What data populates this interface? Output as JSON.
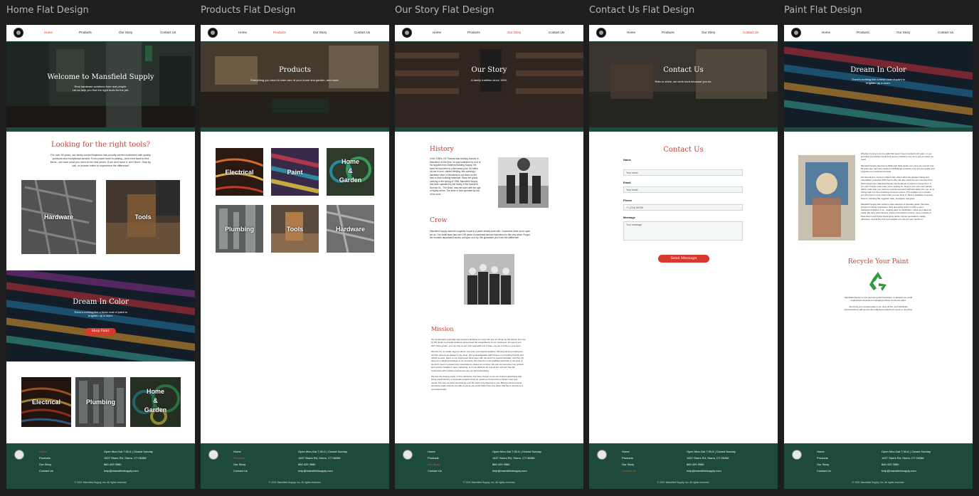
{
  "frames": [
    {
      "title": "Home Flat Design",
      "active_nav": "Home"
    },
    {
      "title": "Products Flat Design",
      "active_nav": "Products"
    },
    {
      "title": "Our Story Flat Design",
      "active_nav": "Our Story"
    },
    {
      "title": "Contact Us Flat Design",
      "active_nav": "Contact Us"
    },
    {
      "title": "Paint Flat Design",
      "active_nav": ""
    }
  ],
  "nav": [
    "Home",
    "Products",
    "Our Story",
    "Contact Us"
  ],
  "home": {
    "hero_title": "Welcome to Mansfield Supply",
    "hero_sub_1": "Real hardware solutions from real people.",
    "hero_sub_2": "Let us help you find the right tools for the job.",
    "heading": "Looking for the right tools?",
    "intro_1": "For over 50 years, our family-owned business has proudly carried customers with quality",
    "intro_2": "products and exceptional service. From power tools to plating—and even hard-to-find",
    "intro_3": "items—we have what you need at the best prices. If we don't have it, we'll find it. Stop by,",
    "intro_4": "call, or browse online to experience the difference!",
    "tile_hardware": "Hardware",
    "tile_tools": "Tools",
    "dream_title": "Dream In Color",
    "dream_sub_1": "There's nothing like a fresh coat of paint to",
    "dream_sub_2": "brighten up a room.",
    "shop_paint": "Shop Paint",
    "tile_electrical": "Electrical",
    "tile_plumbing": "Plumbing",
    "tile_home_1": "Home",
    "tile_home_2": "&",
    "tile_home_3": "Garden"
  },
  "products": {
    "hero_title": "Products",
    "hero_sub": "Everything you need to take care of your home and garden, and more.",
    "tiles": [
      "Electrical",
      "Paint",
      "Home",
      "&",
      "Garden",
      "Plumbing",
      "Tools",
      "Hardware"
    ]
  },
  "story": {
    "hero_title": "Our Story",
    "hero_sub": "A family tradition since 1954.",
    "history_heading": "History",
    "history_text": [
      "In the 1950s, Ed Thomas was working houses in",
      "Mansfield. At the time, he was frustrated by a lot of",
      "his supplies from Eastford Building Supply, the",
      "store he had been to a few years prior. Ed failed",
      "his car in love, started thinking, like opening a",
      "hardware store in Mansfield to cut down on the",
      "trips to fetch building materials. Since the grand",
      "opening in the spring of 1954, Mansfield Supply",
      "has been operated by the family of the founder's",
      "Norman Sr., 'The Boss', was the store with the age",
      "of eighty-seven. The store is now operated by two",
      "of his sons."
    ],
    "crew_heading": "Crew",
    "crew_text": [
      "Mansfield Supply owes its longevity in part to a years steady work with. Customers drive up for open",
      "we do. Our small team has over 150 years of combined service experience in this very store. Forget",
      "the monster department stores, and give us a try. We guarantee you'll see the difference!"
    ],
    "mission_heading": "Mission",
    "mission_text": [
      "Our lumberyard yesterday was proved a lifesaver to many! We are not driven by the bottom line, but",
      "by the desire to provide solutions and exceed the expectations of our customers. So even if you",
      "don't have a barn, you can rely on our tools and staff over 3 wise, you get a smile on your face!",
      "",
      "We don't try to imitate big box stores, but to be your helpful neighbor. We hire full time employees,",
      "and the owners are always in the shop. Our knowledgeable staff focuses on providing friendly and",
      "helpful service. Many of our employees have been with the store for several decades, and they all",
      "have an in-depth knowledge of our products. We have the most qualified retail help in the area. If",
      "we don't meet or exceed your expectations, please let us know. We put our resources into product",
      "and service instead of mass marketing, so if you think we do a good job, tell your friends!",
      "Customers with positive experiences are our best advertising.",
      "",
      "We love the buying power of Ace Hardware, but have chosen to opt out of direct advertising that",
      "being maximized by a corporate program frees up assets and resources to better meet your",
      "needs. The way we have survived for over 60 years is by listening to you. Being local and owner",
      "operated means that we are able to serve you much better than any place that has to answer to a",
      "corporate board."
    ]
  },
  "contact": {
    "hero_title": "Contact Us",
    "hero_sub": "Rain or shine, we work hard because you do.",
    "heading": "Contact Us",
    "name_label": "Name",
    "name_placeholder": "Your name",
    "email_label": "Email",
    "email_placeholder": "Your email",
    "phone_label": "Phone",
    "phone_placeholder": "+1 (234) 56789",
    "message_label": "Message",
    "message_placeholder": "Your message",
    "send": "Send Message"
  },
  "paint": {
    "hero_title": "Dream In Color",
    "hero_sub_1": "There's nothing like a fresh coat of paint to",
    "hero_sub_2": "brighten up a room.",
    "text": [
      "Whether it's time to do the walls that haven't been touched in 20 years, or you",
      "just think your kitchen would look good in cranberry red, we've got you what you",
      "need.",
      "",
      "Mansfield Supply has been a Pittsburgh Paint dealer ever since we opened over",
      "50 years ago. We have stocked on Pittsburgh products to be sure the quality and",
      "expertise our customers demand.",
      "",
      "Our favorite line of paint is Manor Hall, which offers the greatest hiding and",
      "'cleanability' properties PPG has to offer. We also stock the very low-odor Pure",
      "Performance line. Mansfield Supply has hundreds of colors to choose from. If",
      "you can't find the exact color you're looking for, bring in your own color sample",
      "(fabric, paint chip, etc.) and our experienced paint staff will match it for you, at no",
      "charge with our color-matching computer system. This enables us to provide",
      "you with paint in more colors than you can think of. Paint is available in several",
      "sheens, including flat, eggshell, satin, semigloss, and gloss.",
      "",
      "Mansfield Supply also carries a wide selection of specialty paints. We have",
      "primers for finicky projections, deck and siding stains in solid or semi-",
      "transparent finishes or oil-, marking paint for sterilization, paints and stains for",
      "metal. We carry paint thinners, interior and exterior primers, many varieties of",
      "Rust-Oleum and Krylon brand spray paints, interior renovations, caulks,",
      "adhesives, and all the tools and supplies you can get your hands on."
    ],
    "recycle_heading": "Recycle Your Paint",
    "recycle_1": "Mansfield Supply is now partnering with PaintCare, a national non-profit",
    "recycle_2": "organization devoted to managing leftover consumer paint.",
    "recycle_3": "Just bring your unused paint in our drop-off bin, and PaintCare",
    "recycle_4": "representatives will remove the collected products for reuse or recycling."
  },
  "footer": {
    "links": [
      "Home",
      "Products",
      "Our Story",
      "Contact Us"
    ],
    "hours": "Open Mon-Sat 7:30-6 | Closed Sunday",
    "address": "1527 Storrs Rd, Storrs, CT 06268",
    "phone": "860 429 3980",
    "email": "help@mansfieldsupply.com",
    "copyright": "© 2021 Mansfield Supply, Inc. All rights reserved."
  },
  "colors": {
    "brand_green": "#1d4a3c",
    "accent_red": "#d63a2f",
    "canvas": "#1e1e1e"
  }
}
